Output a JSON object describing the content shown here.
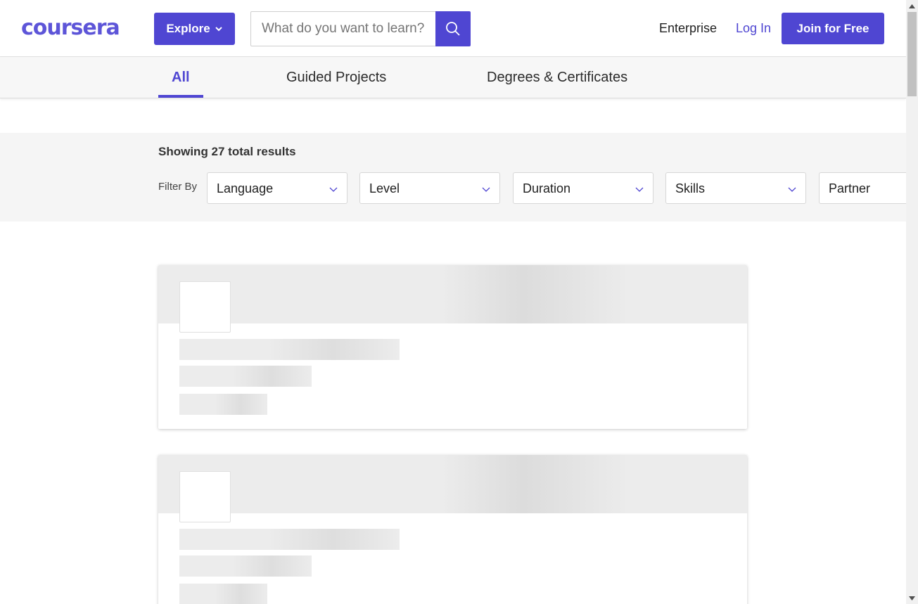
{
  "header": {
    "logo": "coursera",
    "explore_label": "Explore",
    "search_placeholder": "What do you want to learn?",
    "enterprise_label": "Enterprise",
    "login_label": "Log In",
    "join_label": "Join for Free"
  },
  "tabs": [
    {
      "label": "All",
      "active": true
    },
    {
      "label": "Guided Projects",
      "active": false
    },
    {
      "label": "Degrees & Certificates",
      "active": false
    }
  ],
  "filters": {
    "results_text": "Showing 27 total results",
    "filter_by_label": "Filter By",
    "dropdowns": [
      {
        "label": "Language"
      },
      {
        "label": "Level"
      },
      {
        "label": "Duration"
      },
      {
        "label": "Skills"
      },
      {
        "label": "Partner"
      }
    ]
  },
  "colors": {
    "brand": "#4f46d2",
    "logo": "#5d55d8",
    "filter_bar_bg": "#f5f5f5",
    "skeleton": "#ececec"
  },
  "icons": {
    "explore_chevron": "chevron-down-icon",
    "search": "search-icon",
    "dropdown_chevron": "chevron-down-icon"
  }
}
